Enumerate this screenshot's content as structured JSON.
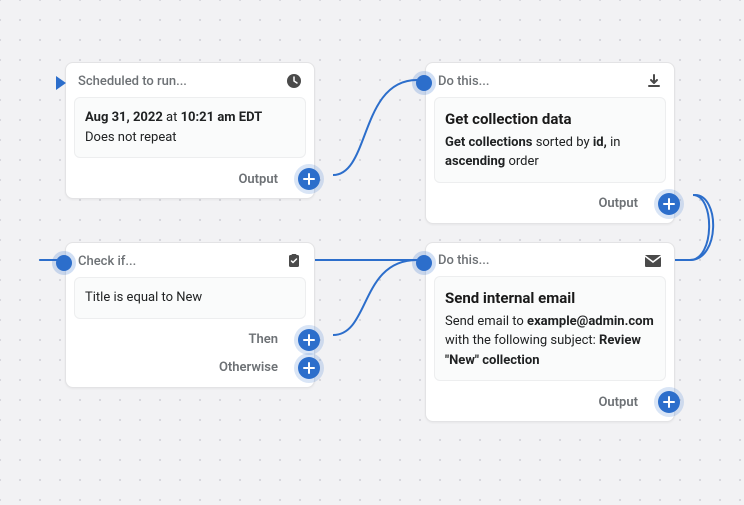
{
  "nodes": {
    "scheduled": {
      "title": "Scheduled to run...",
      "date": "Aug 31, 2022",
      "at": "at",
      "time": "10:21 am EDT",
      "repeat": "Does not repeat",
      "output_label": "Output"
    },
    "getcollection": {
      "title": "Do this...",
      "heading": "Get collection data",
      "desc_prefix": "Get collections",
      "desc_sortedby": "sorted by",
      "desc_field": "id,",
      "desc_in": "in",
      "desc_order": "ascending",
      "desc_suffix": "order",
      "output_label": "Output"
    },
    "check": {
      "title": "Check if...",
      "condition": "Title is equal to New",
      "then_label": "Then",
      "otherwise_label": "Otherwise"
    },
    "email": {
      "title": "Do this...",
      "heading": "Send internal email",
      "line1": "Send email to",
      "addr": "example@admin.com",
      "line2_a": "with the following subject:",
      "subject": "Review \"New\" collection",
      "output_label": "Output"
    }
  }
}
